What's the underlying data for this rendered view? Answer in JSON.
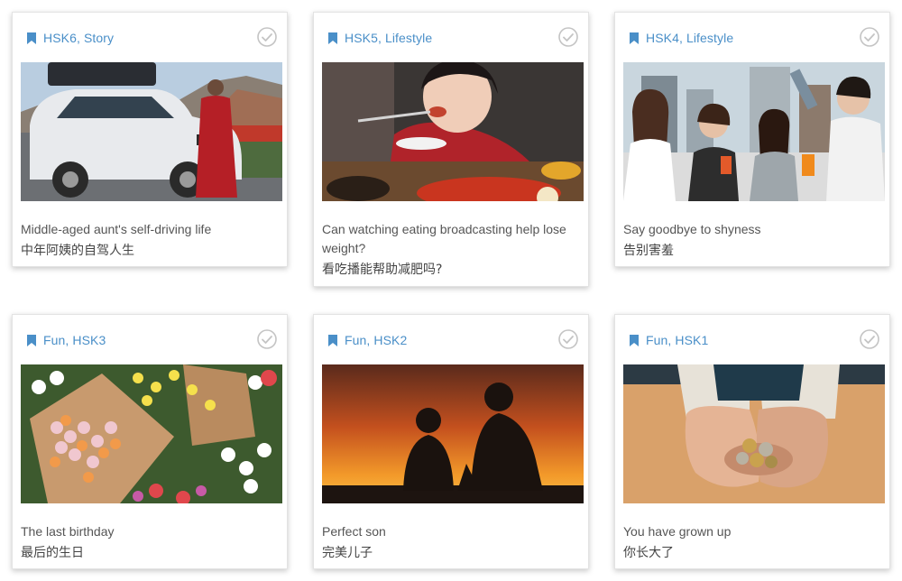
{
  "cards": [
    {
      "tag": "HSK6, Story",
      "title_en": "Middle-aged aunt's self-driving life",
      "title_zh": "中年阿姨的自驾人生"
    },
    {
      "tag": "HSK5, Lifestyle",
      "title_en": "Can watching eating broadcasting help lose weight?",
      "title_zh": "看吃播能帮助减肥吗?"
    },
    {
      "tag": "HSK4, Lifestyle",
      "title_en": "Say goodbye to shyness",
      "title_zh": "告别害羞"
    },
    {
      "tag": "Fun, HSK3",
      "title_en": "The last birthday",
      "title_zh": "最后的生日"
    },
    {
      "tag": "Fun, HSK2",
      "title_en": "Perfect son",
      "title_zh": "完美儿子"
    },
    {
      "tag": "Fun, HSK1",
      "title_en": "You have grown up",
      "title_zh": "你长大了"
    }
  ],
  "icons": {
    "tag": "bookmark-icon",
    "status": "check-circle-icon"
  },
  "colors": {
    "tag_text": "#4a8fc8",
    "check_outline": "#c4c4c4"
  }
}
